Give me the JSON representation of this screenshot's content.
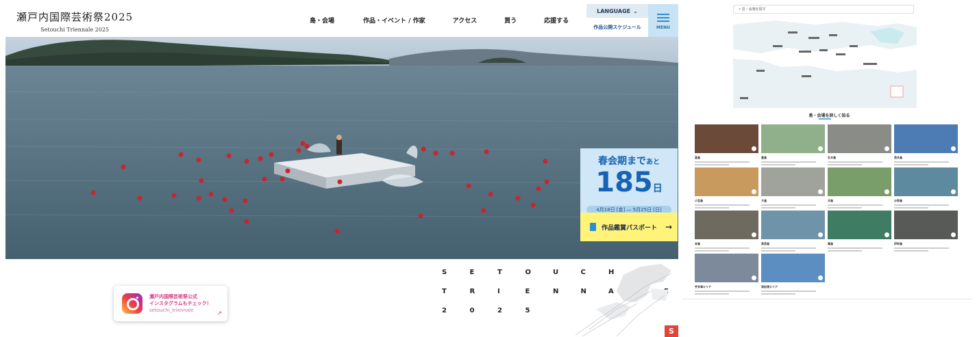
{
  "header": {
    "logo_ja": "瀬戸内国際芸術祭2025",
    "logo_en": "Setouchi Triennale 2025",
    "nav": [
      "島・会場",
      "作品・イベント / 作家",
      "アクセス",
      "買う",
      "応援する"
    ],
    "language_label": "LANGUAGE",
    "schedule_label": "作品公開スケジュール",
    "menu_label": "MENU"
  },
  "countdown": {
    "prefix": "春会期まで",
    "suffix": "あと",
    "days": "185",
    "days_unit": "日",
    "dates": "4月18日 [金] — 5月25日 [日]"
  },
  "passport": {
    "label": "作品鑑賞パスポート",
    "arrow": "→"
  },
  "instagram": {
    "line1": "瀬戸内国際芸術祭公式",
    "line2": "インスタグラムもチェック！",
    "handle": "setouchi_triennale"
  },
  "triennale_letters": [
    [
      "S",
      "E",
      "T",
      "O",
      "U",
      "C",
      "H",
      "I"
    ],
    [
      "T",
      "R",
      "I",
      "E",
      "N",
      "N",
      "A",
      "L",
      "E"
    ],
    [
      "2",
      "0",
      "2",
      "5"
    ]
  ],
  "thumbnail": {
    "heading": "島・会場を詳しく知る",
    "cards": [
      {
        "name": "直島",
        "color": "#6b4a3a"
      },
      {
        "name": "豊島",
        "color": "#8fb08a"
      },
      {
        "name": "女木島",
        "color": "#8a8c88"
      },
      {
        "name": "男木島",
        "color": "#4d7bb4"
      },
      {
        "name": "小豆島",
        "color": "#c99a5d"
      },
      {
        "name": "大島",
        "color": "#9fa39b"
      },
      {
        "name": "犬島",
        "color": "#7a9e6a"
      },
      {
        "name": "沙弥島",
        "color": "#5d8a9f"
      },
      {
        "name": "本島",
        "color": "#6f6a60"
      },
      {
        "name": "高見島",
        "color": "#6f93a8"
      },
      {
        "name": "粟島",
        "color": "#3f7c64"
      },
      {
        "name": "伊吹島",
        "color": "#585a57"
      },
      {
        "name": "宇多津エリア",
        "color": "#7c8a9b"
      },
      {
        "name": "高松港エリア",
        "color": "#5d8ec2"
      }
    ]
  }
}
